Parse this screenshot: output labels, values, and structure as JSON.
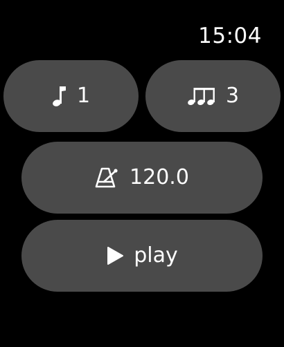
{
  "status": {
    "time": "15:04"
  },
  "controls": {
    "beat": {
      "icon": "eighth-note-icon",
      "value": "1"
    },
    "subdivision": {
      "icon": "triplet-notes-icon",
      "value": "3"
    },
    "tempo": {
      "icon": "metronome-icon",
      "value": "120.0"
    },
    "play": {
      "icon": "play-icon",
      "label": "play"
    }
  },
  "colors": {
    "background": "#000000",
    "button": "#4a4a4a",
    "text": "#ffffff"
  }
}
